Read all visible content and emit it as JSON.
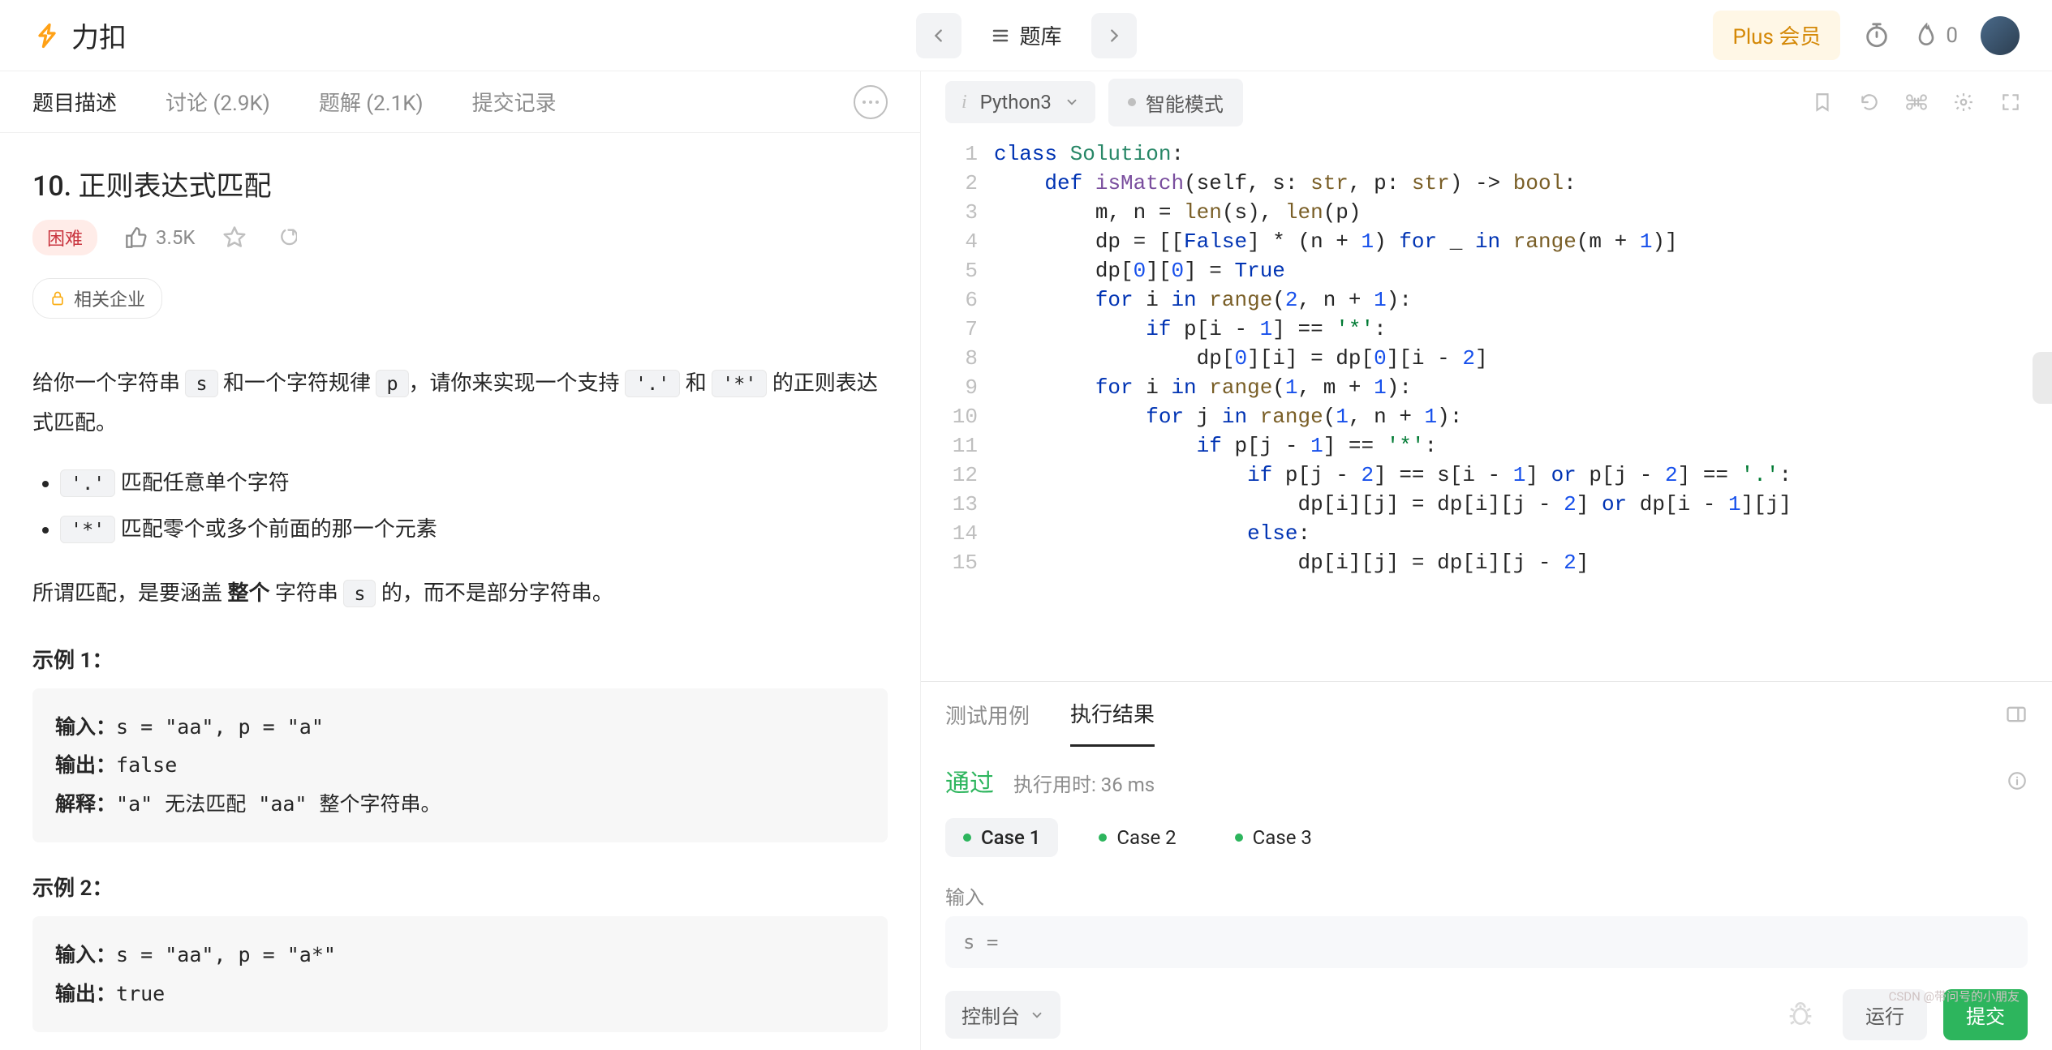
{
  "brand": "力扣",
  "nav": {
    "library": "题库",
    "plus": "Plus 会员",
    "streak": "0"
  },
  "left_tabs": {
    "desc": "题目描述",
    "discuss": "讨论 (2.9K)",
    "solutions": "题解 (2.1K)",
    "submissions": "提交记录"
  },
  "problem": {
    "title": "10. 正则表达式匹配",
    "difficulty": "困难",
    "likes": "3.5K",
    "company_tag": "相关企业",
    "p1_a": "给你一个字符串 ",
    "p1_s": "s",
    "p1_b": " 和一个字符规律 ",
    "p1_p": "p",
    "p1_c": "，请你来实现一个支持 ",
    "p1_dot": "'.'",
    "p1_d": " 和 ",
    "p1_star": "'*'",
    "p1_e": " 的正则表达式匹配。",
    "b1_code": "'.'",
    "b1_text": " 匹配任意单个字符",
    "b2_code": "'*'",
    "b2_text": " 匹配零个或多个前面的那一个元素",
    "p2_a": "所谓匹配，是要涵盖 ",
    "p2_bold": "整个 ",
    "p2_b": "字符串 ",
    "p2_s": "s",
    "p2_c": " 的，而不是部分字符串。",
    "ex1_head": "示例 1：",
    "ex1_in_lbl": "输入：",
    "ex1_in": "s = \"aa\", p = \"a\"",
    "ex1_out_lbl": "输出：",
    "ex1_out": "false",
    "ex1_exp_lbl": "解释：",
    "ex1_exp": "\"a\" 无法匹配 \"aa\" 整个字符串。",
    "ex2_head": "示例 2：",
    "ex2_in_lbl": "输入：",
    "ex2_in": "s = \"aa\", p = \"a*\"",
    "ex2_out_lbl": "输出：",
    "ex2_out": "true"
  },
  "editor": {
    "language": "Python3",
    "smart_mode": "智能模式",
    "code": [
      [
        [
          "kw",
          "class"
        ],
        [
          "",
          " "
        ],
        [
          "cls",
          "Solution"
        ],
        [
          "",
          ":"
        ]
      ],
      [
        [
          "",
          "    "
        ],
        [
          "kw",
          "def"
        ],
        [
          "",
          " "
        ],
        [
          "fn",
          "isMatch"
        ],
        [
          "",
          "(self, s: "
        ],
        [
          "builtin",
          "str"
        ],
        [
          "",
          ", p: "
        ],
        [
          "builtin",
          "str"
        ],
        [
          "",
          ") -> "
        ],
        [
          "builtin",
          "bool"
        ],
        [
          "",
          ":"
        ]
      ],
      [
        [
          "",
          "        m, n = "
        ],
        [
          "builtin",
          "len"
        ],
        [
          "",
          "(s), "
        ],
        [
          "builtin",
          "len"
        ],
        [
          "",
          "(p)"
        ]
      ],
      [
        [
          "",
          "        dp = [["
        ],
        [
          "bool",
          "False"
        ],
        [
          "",
          "] * (n + "
        ],
        [
          "num",
          "1"
        ],
        [
          "",
          ") "
        ],
        [
          "kw",
          "for"
        ],
        [
          "",
          " _ "
        ],
        [
          "kw",
          "in"
        ],
        [
          "",
          " "
        ],
        [
          "builtin",
          "range"
        ],
        [
          "",
          "(m + "
        ],
        [
          "num",
          "1"
        ],
        [
          "",
          ")]"
        ]
      ],
      [
        [
          "",
          "        dp["
        ],
        [
          "num",
          "0"
        ],
        [
          "",
          "]["
        ],
        [
          "num",
          "0"
        ],
        [
          "",
          "] = "
        ],
        [
          "bool",
          "True"
        ]
      ],
      [
        [
          "",
          "        "
        ],
        [
          "kw",
          "for"
        ],
        [
          "",
          " i "
        ],
        [
          "kw",
          "in"
        ],
        [
          "",
          " "
        ],
        [
          "builtin",
          "range"
        ],
        [
          "",
          "("
        ],
        [
          "num",
          "2"
        ],
        [
          "",
          ", n + "
        ],
        [
          "num",
          "1"
        ],
        [
          "",
          "):"
        ]
      ],
      [
        [
          "",
          "            "
        ],
        [
          "kw",
          "if"
        ],
        [
          "",
          " p[i - "
        ],
        [
          "num",
          "1"
        ],
        [
          "",
          "] == "
        ],
        [
          "str",
          "'*'"
        ],
        [
          "",
          ":"
        ]
      ],
      [
        [
          "",
          "                dp["
        ],
        [
          "num",
          "0"
        ],
        [
          "",
          "][i] = dp["
        ],
        [
          "num",
          "0"
        ],
        [
          "",
          "][i - "
        ],
        [
          "num",
          "2"
        ],
        [
          "",
          "]"
        ]
      ],
      [
        [
          "",
          "        "
        ],
        [
          "kw",
          "for"
        ],
        [
          "",
          " i "
        ],
        [
          "kw",
          "in"
        ],
        [
          "",
          " "
        ],
        [
          "builtin",
          "range"
        ],
        [
          "",
          "("
        ],
        [
          "num",
          "1"
        ],
        [
          "",
          ", m + "
        ],
        [
          "num",
          "1"
        ],
        [
          "",
          "):"
        ]
      ],
      [
        [
          "",
          "            "
        ],
        [
          "kw",
          "for"
        ],
        [
          "",
          " j "
        ],
        [
          "kw",
          "in"
        ],
        [
          "",
          " "
        ],
        [
          "builtin",
          "range"
        ],
        [
          "",
          "("
        ],
        [
          "num",
          "1"
        ],
        [
          "",
          ", n + "
        ],
        [
          "num",
          "1"
        ],
        [
          "",
          "):"
        ]
      ],
      [
        [
          "",
          "                "
        ],
        [
          "kw",
          "if"
        ],
        [
          "",
          " p[j - "
        ],
        [
          "num",
          "1"
        ],
        [
          "",
          "] == "
        ],
        [
          "str",
          "'*'"
        ],
        [
          "",
          ":"
        ]
      ],
      [
        [
          "",
          "                    "
        ],
        [
          "kw",
          "if"
        ],
        [
          "",
          " p[j - "
        ],
        [
          "num",
          "2"
        ],
        [
          "",
          "] == s[i - "
        ],
        [
          "num",
          "1"
        ],
        [
          "",
          "] "
        ],
        [
          "kw",
          "or"
        ],
        [
          "",
          " p[j - "
        ],
        [
          "num",
          "2"
        ],
        [
          "",
          "] == "
        ],
        [
          "str",
          "'.'"
        ],
        [
          "",
          ":"
        ]
      ],
      [
        [
          "",
          "                        dp[i][j] = dp[i][j - "
        ],
        [
          "num",
          "2"
        ],
        [
          "",
          "] "
        ],
        [
          "kw",
          "or"
        ],
        [
          "",
          " dp[i - "
        ],
        [
          "num",
          "1"
        ],
        [
          "",
          "][j]"
        ]
      ],
      [
        [
          "",
          "                    "
        ],
        [
          "kw",
          "else"
        ],
        [
          "",
          ":"
        ]
      ],
      [
        [
          "",
          "                        dp[i][j] = dp[i][j - "
        ],
        [
          "num",
          "2"
        ],
        [
          "",
          "]"
        ]
      ]
    ]
  },
  "test": {
    "tab_cases": "测试用例",
    "tab_result": "执行结果",
    "pass": "通过",
    "runtime_label": "执行用时: ",
    "runtime": "36 ms",
    "cases": [
      "Case 1",
      "Case 2",
      "Case 3"
    ],
    "input_label": "输入",
    "input_value": "s =",
    "console": "控制台",
    "run": "运行",
    "submit": "提交"
  },
  "watermark": "CSDN @带问号的小朋友"
}
